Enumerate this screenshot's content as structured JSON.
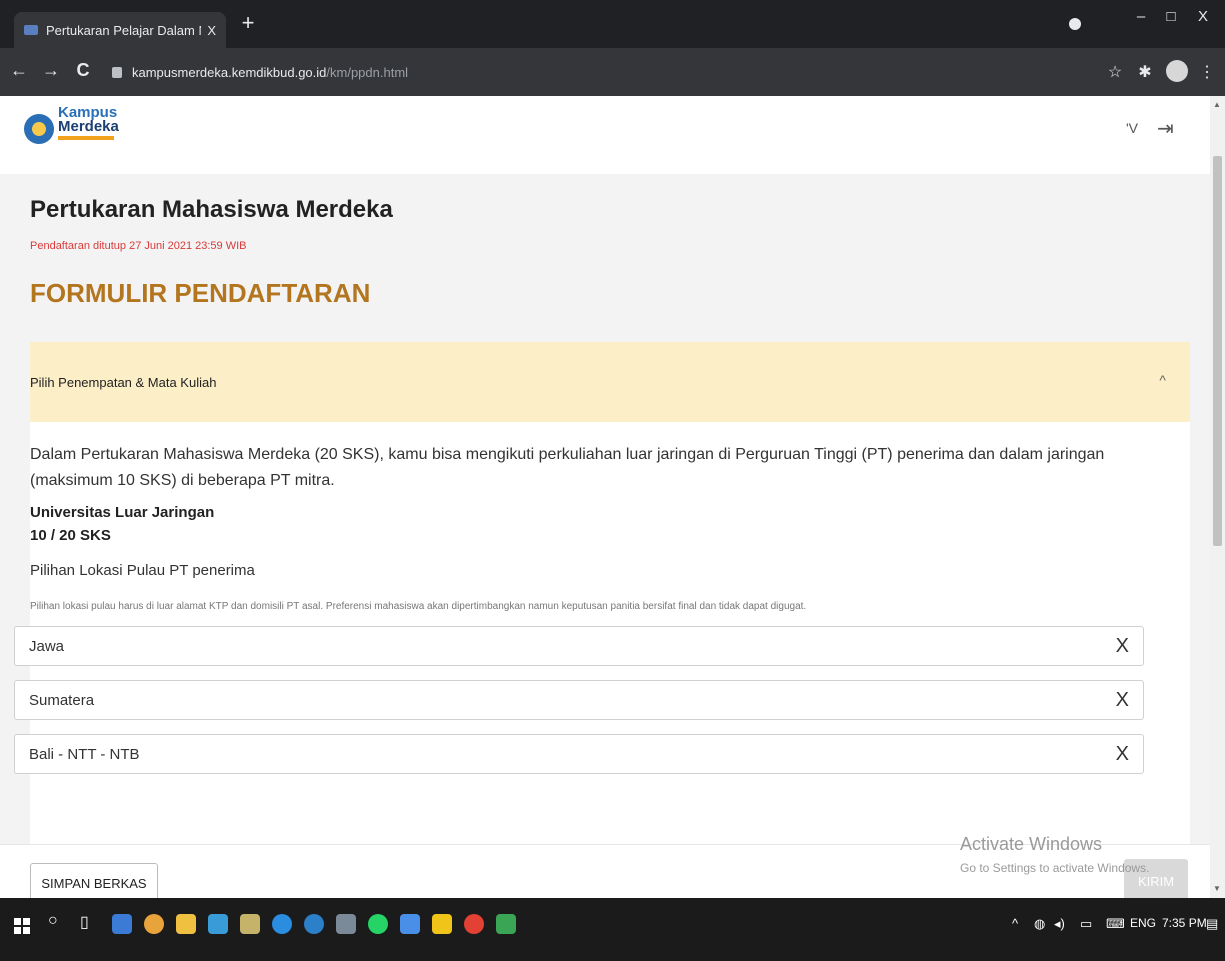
{
  "browser": {
    "tab_title": "Pertukaran Pelajar Dalam Negeri",
    "tab_close": "X",
    "new_tab": "+",
    "url_host": "kampusmerdeka.kemdikbud.go.id",
    "url_path": "/km/ppdn.html",
    "back": "←",
    "forward": "→",
    "reload": "C",
    "star": "☆",
    "menu": "⋮",
    "minimize": "–",
    "maximize": "□",
    "close": "X"
  },
  "header": {
    "logo_line1": "Kampus",
    "logo_line2": "Merdeka",
    "user_initial": "'V",
    "logout_icon": "⇥"
  },
  "main": {
    "page_title": "Pertukaran Mahasiswa Merdeka",
    "deadline": "Pendaftaran ditutup 27 Juni 2021 23:59 WIB",
    "form_title": "FORMULIR PENDAFTARAN"
  },
  "panel": {
    "heading": "Pilih Penempatan & Mata Kuliah",
    "toggle": "^",
    "description": "Dalam Pertukaran Mahasiswa Merdeka (20 SKS), kamu bisa mengikuti perkuliahan luar jaringan di Perguruan Tinggi (PT) penerima dan dalam jaringan (maksimum 10 SKS) di beberapa PT mitra.",
    "uni_title": "Universitas Luar Jaringan",
    "sks": "10 / 20 SKS",
    "location_label": "Pilihan Lokasi Pulau PT penerima",
    "note": "Pilihan lokasi pulau harus di luar alamat KTP dan domisili PT asal. Preferensi mahasiswa akan dipertimbangkan namun keputusan panitia bersifat final dan tidak dapat digugat.",
    "options": [
      {
        "label": "Jawa",
        "remove": "X"
      },
      {
        "label": "Sumatera",
        "remove": "X"
      },
      {
        "label": "Bali - NTT - NTB",
        "remove": "X"
      }
    ]
  },
  "footer": {
    "save_label": "SIMPAN BERKAS",
    "send_label": "KIRIM"
  },
  "watermark": {
    "line1": "Activate Windows",
    "line2": "Go to Settings to activate Windows."
  },
  "taskbar": {
    "language": "ENG",
    "time": "7:35 PM",
    "tray_caret": "^"
  },
  "colors": {
    "accent": "#b3761f",
    "deadline": "#d93b3b",
    "panel_header": "#fcefc8",
    "brand_blue": "#2a6fb6"
  }
}
